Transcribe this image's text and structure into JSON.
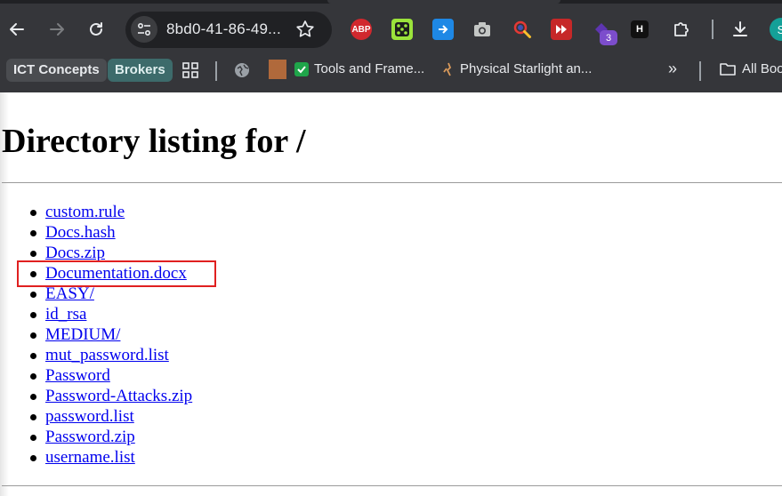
{
  "browser": {
    "url": "8bd0-41-86-49...",
    "extension_badge": "3",
    "extensions": [
      "abp-icon",
      "dice-icon",
      "arrow-square-icon",
      "camera-icon",
      "magnifier-icon",
      "rewind-icon",
      "puzzle-leaf-icon",
      "h-icon"
    ],
    "profile_initial": "S"
  },
  "bookmarks": {
    "chips": [
      "ICT Concepts",
      "Brokers"
    ],
    "items": [
      "Tools and Frame...",
      "Physical Starlight an..."
    ],
    "overflow": "»",
    "all_bookmarks": "All Boo"
  },
  "page": {
    "heading": "Directory listing for /",
    "files": [
      "custom.rule",
      "Docs.hash",
      "Docs.zip",
      "Documentation.docx",
      "EASY/",
      "id_rsa",
      "MEDIUM/",
      "mut_password.list",
      "Password",
      "Password-Attacks.zip",
      "password.list",
      "Password.zip",
      "username.list"
    ],
    "highlighted_file": "Documentation.docx"
  },
  "colors": {
    "chrome_bg": "#35363a",
    "link": "#0000ee",
    "highlight": "#e02020"
  }
}
